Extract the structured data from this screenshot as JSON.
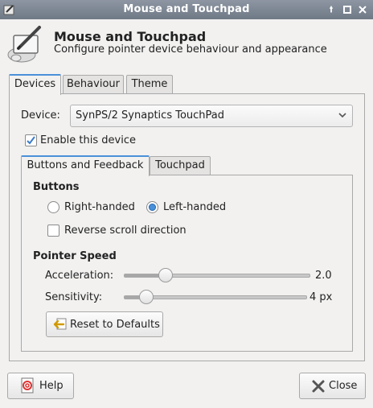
{
  "window": {
    "title": "Mouse and Touchpad"
  },
  "header": {
    "title": "Mouse and Touchpad",
    "subtitle": "Configure pointer device behaviour and appearance"
  },
  "main_tabs": [
    {
      "label": "Devices",
      "active": true
    },
    {
      "label": "Behaviour",
      "active": false
    },
    {
      "label": "Theme",
      "active": false
    }
  ],
  "device": {
    "label": "Device:",
    "selected": "SynPS/2 Synaptics TouchPad",
    "enable_label": "Enable this device",
    "enabled": true
  },
  "sub_tabs": [
    {
      "label": "Buttons and Feedback",
      "active": true
    },
    {
      "label": "Touchpad",
      "active": false
    }
  ],
  "buttons_section": {
    "heading": "Buttons",
    "right_handed": "Right-handed",
    "left_handed": "Left-handed",
    "selected": "left",
    "reverse_scroll": "Reverse scroll direction",
    "reverse_scroll_checked": false
  },
  "pointer_speed": {
    "heading": "Pointer Speed",
    "acceleration_label": "Acceleration:",
    "acceleration_value": "2.0",
    "acceleration_fraction": 0.22,
    "sensitivity_label": "Sensitivity:",
    "sensitivity_value": "4 px",
    "sensitivity_fraction": 0.12,
    "reset_label": "Reset to Defaults"
  },
  "footer": {
    "help_label": "Help",
    "close_label": "Close"
  },
  "colors": {
    "titlebar": "#7a8390",
    "accent": "#4a90d9",
    "background": "#f2f1f0"
  },
  "icons": [
    "app-icon",
    "mouse-pen-icon",
    "checkmark-icon",
    "dropdown-arrow-icon",
    "reset-icon",
    "help-icon",
    "close-icon",
    "window-up-icon",
    "window-maximize-icon",
    "window-close-icon"
  ]
}
